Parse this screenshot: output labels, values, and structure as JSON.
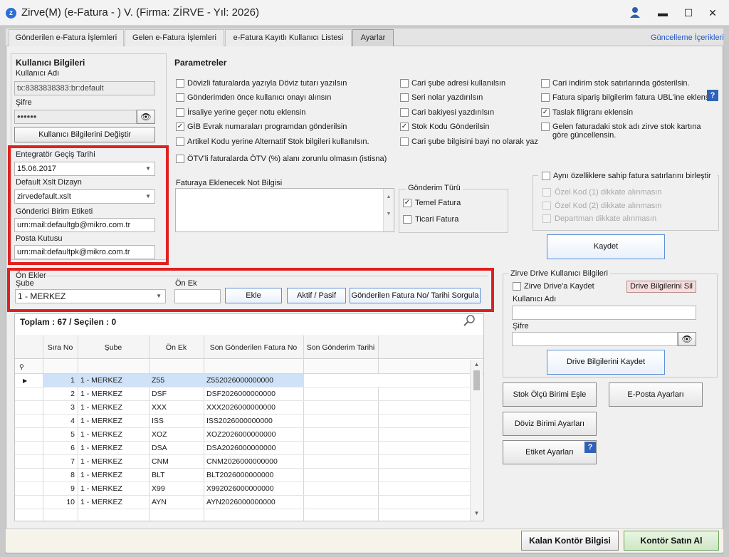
{
  "app": {
    "title": "Zirve(M)  (e-Fatura - ) V. (Firma: ZİRVE - Yıl: 2026)"
  },
  "tabs": [
    "Gönderilen e-Fatura İşlemleri",
    "Gelen e-Fatura İşlemleri",
    "e-Fatura Kayıtlı Kullanıcı Listesi",
    "Ayarlar"
  ],
  "header_link": "Güncelleme İçerikleri",
  "user_info": {
    "title": "Kullanıcı Bilgileri",
    "username_label": "Kullanıcı Adı",
    "username": "tx:8383838383:br:default",
    "password_label": "Şifre",
    "password": "••••••",
    "change_button": "Kullanıcı Bilgilerini Değiştir"
  },
  "integrator": {
    "date_label": "Entegratör Geçiş Tarihi",
    "date": "15.06.2017",
    "xslt_label": "Default Xslt Dizayn",
    "xslt": "zirvedefault.xslt",
    "sender_label": "Gönderici Birim Etiketi",
    "sender": "urn:mail:defaultgb@mikro.com.tr",
    "mailbox_label": "Posta Kutusu",
    "mailbox": "urn:mail:defaultpk@mikro.com.tr"
  },
  "params": {
    "title": "Parametreler",
    "col1": [
      {
        "label": "Dövizli faturalarda yazıyla Döviz tutarı yazılsın",
        "checked": ""
      },
      {
        "label": "Gönderimden önce kullanıcı onayı alınsın",
        "checked": ""
      },
      {
        "label": "İrsaliye yerine geçer notu eklensin",
        "checked": ""
      },
      {
        "label": "GİB Evrak numaraları programdan gönderilsin",
        "checked": "✓"
      },
      {
        "label": "Artikel Kodu yerine Alternatif Stok bilgileri kullanılsın.",
        "checked": ""
      },
      {
        "label": "ÖTV'li faturalarda ÖTV (%) alanı zorunlu olmasın (istisna)",
        "checked": ""
      }
    ],
    "col2": [
      {
        "label": "Cari şube adresi kullanılsın",
        "checked": ""
      },
      {
        "label": "Seri nolar yazdırılsın",
        "checked": ""
      },
      {
        "label": "Cari bakiyesi yazdırılsın",
        "checked": ""
      },
      {
        "label": "Stok Kodu Gönderilsin",
        "checked": "✓"
      },
      {
        "label": "Cari şube bilgisini bayi no olarak yaz",
        "checked": ""
      }
    ],
    "col3": [
      {
        "label": "Cari indirim stok satırlarında gösterilsin.",
        "checked": ""
      },
      {
        "label": "Fatura sipariş bilgilerim fatura UBL'ine eklensin.",
        "checked": ""
      },
      {
        "label": "Taslak filigranı eklensin",
        "checked": "✓"
      },
      {
        "label": "Gelen faturadaki stok adı zirve stok kartına",
        "label2": "göre güncellensin.",
        "checked": ""
      }
    ],
    "note_label": "Faturaya Eklenecek Not Bilgisi",
    "send_type": {
      "title": "Gönderim Türü",
      "options": [
        {
          "label": "Temel Fatura",
          "checked": "✓"
        },
        {
          "label": "Ticari Fatura",
          "checked": ""
        }
      ]
    },
    "merge": {
      "title": "Aynı özelliklere sahip fatura satırlarını birleştir",
      "options": [
        "Özel Kod (1) dikkate alınmasın",
        "Özel Kod (2) dikkate alınmasın",
        "Departman dikkate alınmasın"
      ]
    },
    "save": "Kaydet"
  },
  "prefixes": {
    "title": "Ön Ekler",
    "branch_label": "Şube",
    "branch": "1 - MERKEZ",
    "prefix_label": "Ön Ek",
    "prefix": "",
    "add": "Ekle",
    "toggle": "Aktif / Pasif",
    "query": "Gönderilen Fatura No/ Tarihi Sorgula"
  },
  "grid": {
    "summary": "Toplam : 67 / Seçilen : 0",
    "columns": [
      "Sıra No",
      "Şube",
      "Ön Ek",
      "Son Gönderilen Fatura No",
      "Son Gönderim Tarihi"
    ],
    "rows": [
      [
        "1",
        "1 - MERKEZ",
        "Z55",
        "Z552026000000000",
        ""
      ],
      [
        "2",
        "1 - MERKEZ",
        "DSF",
        "DSF2026000000000",
        ""
      ],
      [
        "3",
        "1 - MERKEZ",
        "XXX",
        "XXX2026000000000",
        ""
      ],
      [
        "4",
        "1 - MERKEZ",
        "ISS",
        "ISS2026000000000",
        ""
      ],
      [
        "5",
        "1 - MERKEZ",
        "XOZ",
        "XOZ2026000000000",
        ""
      ],
      [
        "6",
        "1 - MERKEZ",
        "DSA",
        "DSA2026000000000",
        ""
      ],
      [
        "7",
        "1 - MERKEZ",
        "CNM",
        "CNM2026000000000",
        ""
      ],
      [
        "8",
        "1 - MERKEZ",
        "BLT",
        "BLT2026000000000",
        ""
      ],
      [
        "9",
        "1 - MERKEZ",
        "X99",
        "X992026000000000",
        ""
      ],
      [
        "10",
        "1 - MERKEZ",
        "AYN",
        "AYN2026000000000",
        ""
      ]
    ]
  },
  "drive": {
    "title": "Zirve Drive Kullanıcı Bilgileri",
    "save_checkbox": "Zirve Drive'a Kaydet",
    "delete": "Drive Bilgilerini Sil",
    "username_label": "Kullanıcı Adı",
    "password_label": "Şifre",
    "save": "Drive Bilgilerini Kaydet"
  },
  "buttons": {
    "stock_unit": "Stok Ölçü Birimi Eşle",
    "email": "E-Posta Ayarları",
    "currency": "Döviz Birimi Ayarları",
    "label": "Etiket Ayarları"
  },
  "footer": {
    "credit_info": "Kalan Kontör Bilgisi",
    "buy": "Kontör Satın Al"
  },
  "help_mark": "?",
  "colors": {
    "accent": "#2f63b8",
    "red_highlight": "#e02020",
    "selected_row": "#cfe2f7"
  }
}
